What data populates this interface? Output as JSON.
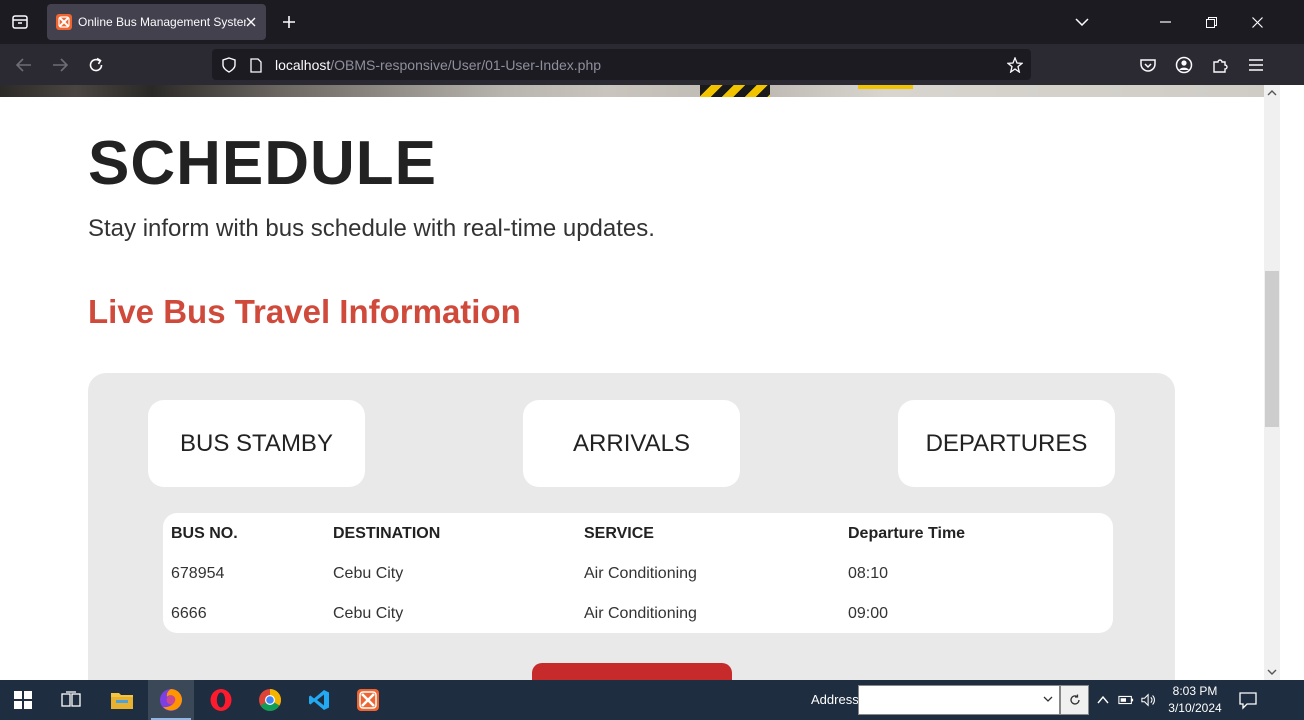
{
  "browser": {
    "tab_title": "Online Bus Management System",
    "url_host": "localhost",
    "url_path": "/OBMS-responsive/User/01-User-Index.php"
  },
  "page": {
    "schedule_title": "SCHEDULE",
    "schedule_subtitle": "Stay inform with bus schedule with real-time updates.",
    "live_title": "Live Bus Travel Information",
    "buttons": [
      "BUS STAMBY",
      "ARRIVALS",
      "DEPARTURES"
    ],
    "table": {
      "headers": [
        "BUS NO.",
        "DESTINATION",
        "SERVICE",
        "Departure Time"
      ],
      "rows": [
        [
          "678954",
          "Cebu City",
          "Air Conditioning",
          "08:10"
        ],
        [
          "6666",
          "Cebu City",
          "Air Conditioning",
          "09:00"
        ]
      ]
    }
  },
  "taskbar": {
    "address_label": "Address",
    "address_value": "",
    "time": "8:03 PM",
    "date": "3/10/2024",
    "apps": [
      "file-explorer",
      "firefox",
      "opera",
      "chrome",
      "vscode",
      "xampp"
    ]
  },
  "colors": {
    "accent_red": "#d04a3c",
    "button_red": "#c62a2a",
    "panel_gray": "#e9e9e9",
    "xampp_orange": "#f0652f"
  }
}
